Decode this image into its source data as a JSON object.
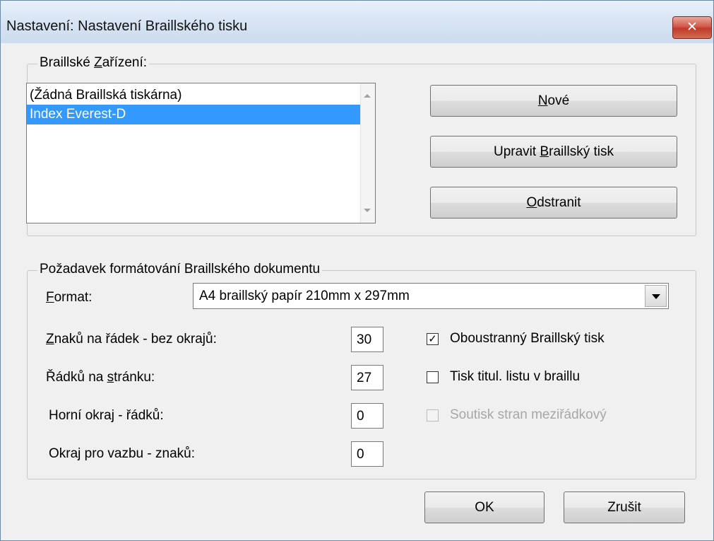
{
  "window": {
    "title": "Nastavení: Nastavení Braillského tisku",
    "close_glyph": "✕"
  },
  "device_group": {
    "label_pre": "Braillské ",
    "label_ul": "Z",
    "label_post": "ařízení:",
    "list_items": [
      "(Žádná Braillská tiskárna)",
      "Index Everest-D"
    ],
    "selected_index": 1,
    "buttons": {
      "new": {
        "pre": "",
        "ul": "N",
        "post": "ové"
      },
      "edit": {
        "pre": "Upravit ",
        "ul": "B",
        "post": "raillský tisk"
      },
      "remove": {
        "pre": "",
        "ul": "O",
        "post": "dstranit"
      }
    }
  },
  "format_group": {
    "label": "Požadavek formátování Braillského dokumentu",
    "format_label": {
      "pre": "",
      "ul": "F",
      "post": "ormat:"
    },
    "format_value": "A4 braillský papír 210mm x 297mm",
    "fields": {
      "chars_per_line": {
        "pre": "",
        "ul": "Z",
        "post": "naků na řádek - bez okrajů:",
        "value": "30"
      },
      "lines_per_page": {
        "pre": "Řádků na ",
        "ul": "s",
        "post": "tránku:",
        "value": "27"
      },
      "top_margin": {
        "label": "Horní okraj - řádků:",
        "value": "0"
      },
      "binding_margin": {
        "label": "Okraj pro vazbu - znaků:",
        "value": "0"
      }
    },
    "checkboxes": {
      "duplex": {
        "label": "Oboustranný  Braillský tisk",
        "checked": true,
        "enabled": true
      },
      "title_page": {
        "label": "Tisk titul. listu v braillu",
        "checked": false,
        "enabled": true
      },
      "interline": {
        "label": "Soutisk stran meziřádkový",
        "checked": false,
        "enabled": false
      }
    }
  },
  "footer": {
    "ok": "OK",
    "cancel": "Zrušit"
  },
  "colors": {
    "selection": "#3399ff",
    "close_button": "#c13a2a"
  }
}
